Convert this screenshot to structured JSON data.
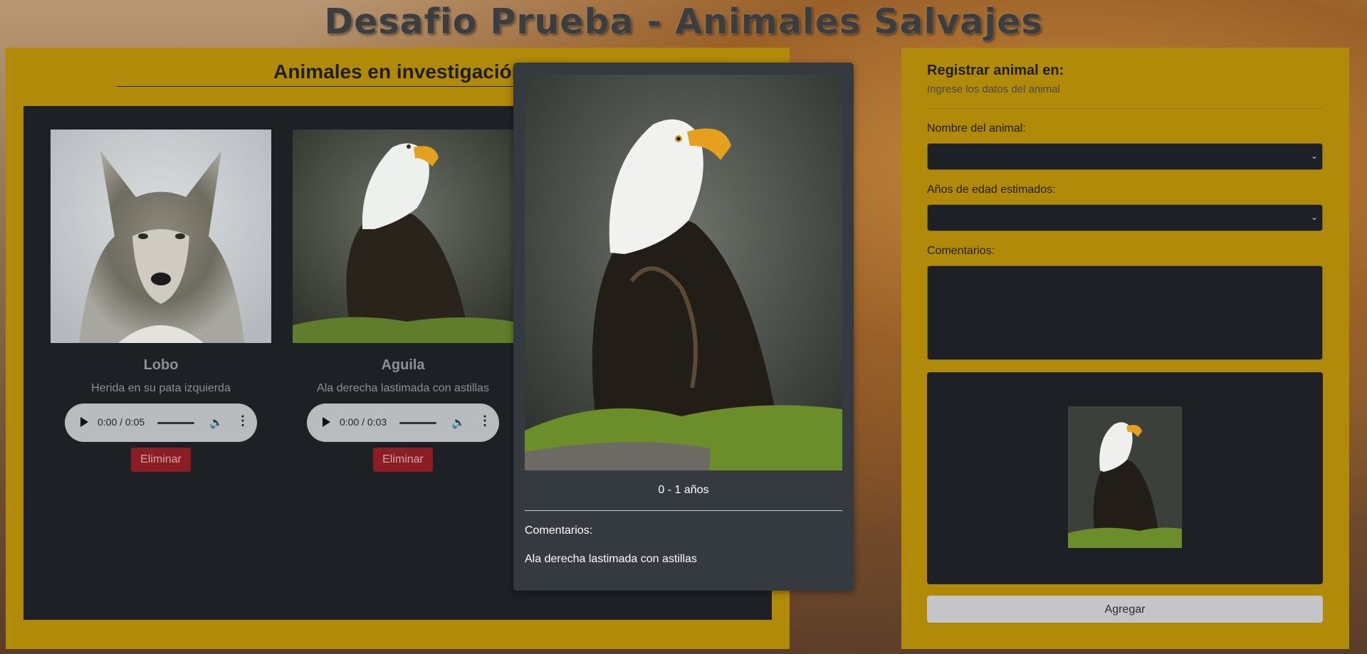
{
  "header": {
    "title": "Desafio Prueba - Animales Salvajes"
  },
  "investigation": {
    "heading": "Animales en investigación",
    "cards": [
      {
        "name": "Lobo",
        "description": "Herida en su pata izquierda",
        "audio_time": "0:00 / 0:05",
        "delete_label": "Eliminar",
        "image": "wolf"
      },
      {
        "name": "Aguila",
        "description": "Ala derecha lastimada con astillas",
        "audio_time": "0:00 / 0:03",
        "delete_label": "Eliminar",
        "image": "eagle"
      }
    ]
  },
  "modal": {
    "image": "eagle",
    "age": "0 - 1 años",
    "comments_label": "Comentarios:",
    "comment": "Ala derecha lastimada con astillas"
  },
  "form": {
    "title": "Registrar animal en:",
    "subtitle": "Ingrese los datos del animal",
    "name_label": "Nombre del animal:",
    "name_value": "",
    "age_label": "Años de edad estimados:",
    "age_value": "",
    "comments_label": "Comentarios:",
    "comments_value": "",
    "preview_image": "eagle",
    "submit_label": "Agregar"
  },
  "colors": {
    "panel": "#b08a08",
    "dark": "#1d2024",
    "modal": "#343a40",
    "danger": "#8b1e24"
  }
}
